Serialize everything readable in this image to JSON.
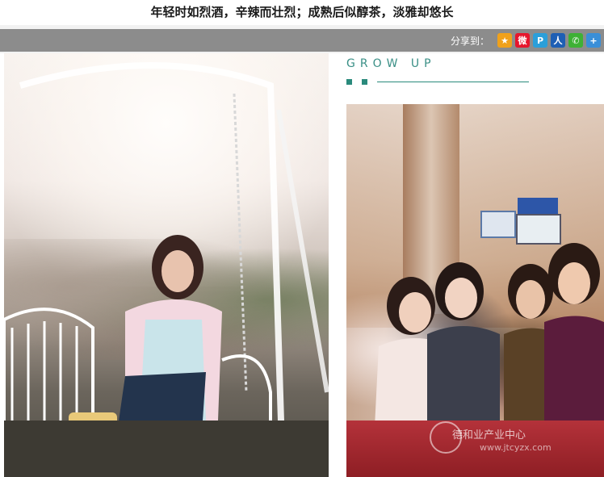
{
  "headline": "年轻时如烈酒，辛辣而壮烈；成熟后似醇茶，淡雅却悠长",
  "share": {
    "label": "分享到：",
    "icons": [
      {
        "name": "qzone-icon",
        "glyph": "★",
        "color": "#f0a11b"
      },
      {
        "name": "weibo-icon",
        "glyph": "微",
        "color": "#e6162d"
      },
      {
        "name": "tencent-weibo-icon",
        "glyph": "P",
        "color": "#2b9fd9"
      },
      {
        "name": "renren-icon",
        "glyph": "人",
        "color": "#1f5fb4"
      },
      {
        "name": "wechat-icon",
        "glyph": "✆",
        "color": "#3eb135"
      },
      {
        "name": "more-share-icon",
        "glyph": "+",
        "color": "#3a8fd8"
      }
    ]
  },
  "section_heading": "GROW UP",
  "accent_color": "#2a8a7c",
  "watermark": {
    "text": "德和业产业中心",
    "url": "www.jtcyzx.com"
  }
}
